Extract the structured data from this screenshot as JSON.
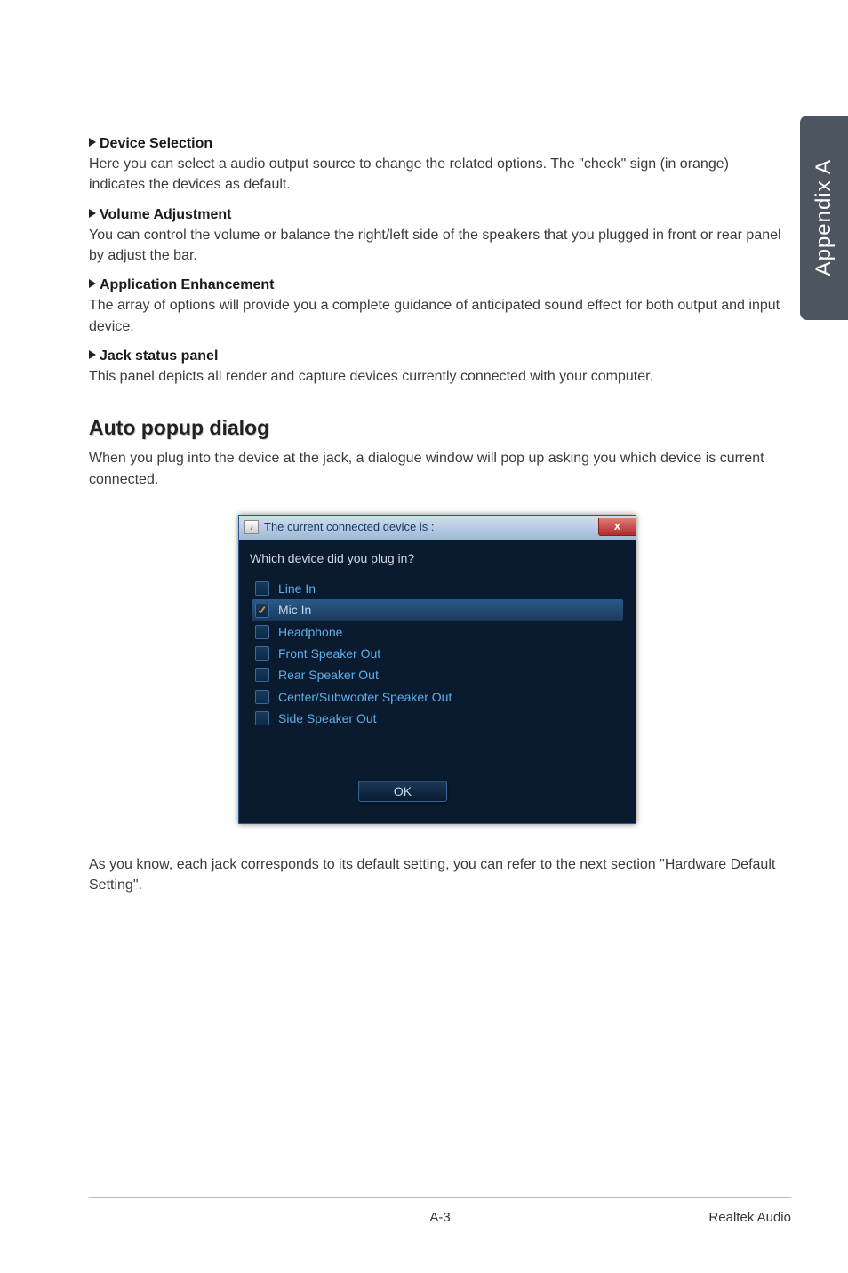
{
  "sidebar": {
    "label": "Appendix A"
  },
  "sections": {
    "device_selection": {
      "title": "Device Selection",
      "text": "Here you can select a audio output source to change the related options. The \"check\" sign (in orange) indicates the devices as default."
    },
    "volume_adjustment": {
      "title": "Volume Adjustment",
      "text": "You can control the volume or balance the right/left side of the speakers that you plugged in front or rear panel by adjust the bar."
    },
    "application_enhancement": {
      "title": "Application Enhancement",
      "text": "The array of options will provide you a complete guidance of anticipated sound effect for both output and input device."
    },
    "jack_status": {
      "title": "Jack status panel",
      "text": "This panel depicts all render and capture devices currently connected with your computer."
    },
    "auto_popup": {
      "heading": "Auto popup dialog",
      "text": "When you plug into the device at the jack, a dialogue window will pop up asking you which device is current connected."
    },
    "closing": "As you know, each jack corresponds to its default setting, you can refer to the next section \"Hardware Default Setting\"."
  },
  "dialog": {
    "title": "The current connected device is :",
    "question": "Which device did you plug in?",
    "devices": {
      "line_in": "Line In",
      "mic_in": "Mic In",
      "headphone": "Headphone",
      "front_speaker": "Front Speaker Out",
      "rear_speaker": "Rear Speaker Out",
      "center_sub": "Center/Subwoofer Speaker Out",
      "side_speaker": "Side Speaker Out"
    },
    "ok_label": "OK",
    "close_label": "x"
  },
  "footer": {
    "page": "A-3",
    "section": "Realtek Audio"
  }
}
